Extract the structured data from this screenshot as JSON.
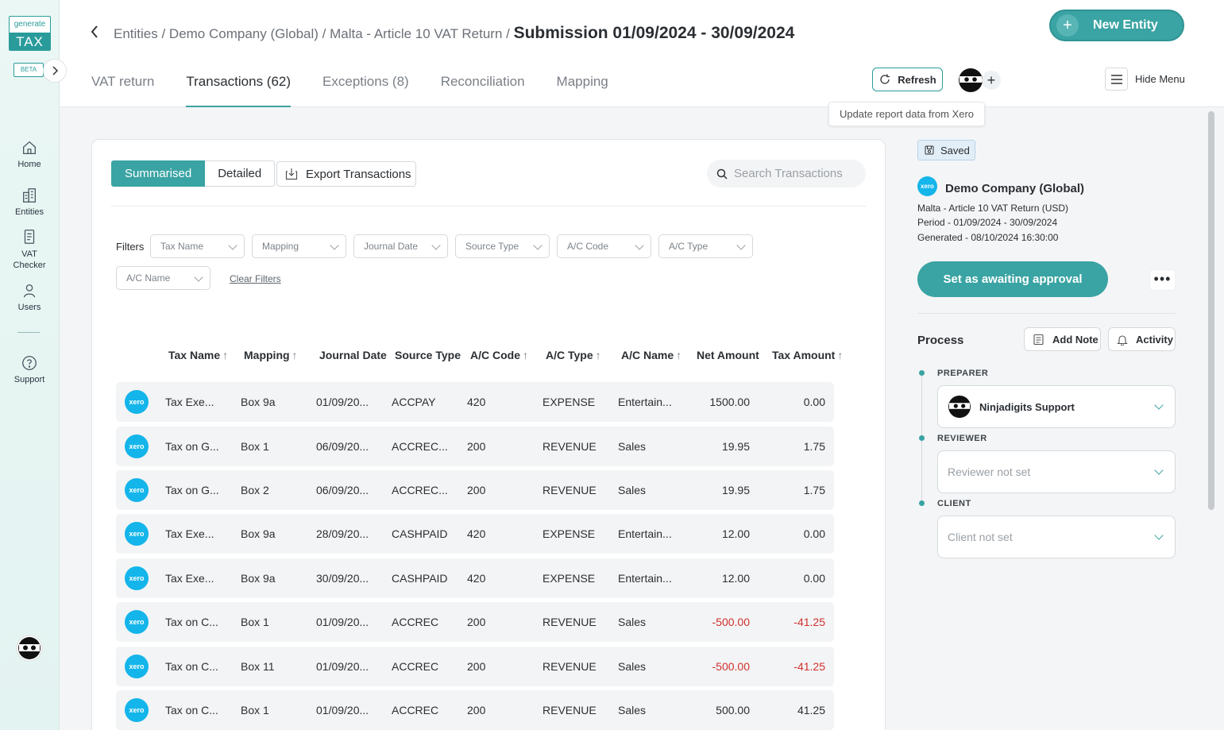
{
  "app": {
    "logo_top": "generate",
    "logo_bottom": "TAX",
    "beta": "BETA"
  },
  "sidebar": {
    "items": [
      {
        "label": "Home",
        "icon": "home-icon"
      },
      {
        "label": "Entities",
        "icon": "building-icon"
      },
      {
        "label": "VAT Checker",
        "icon": "document-icon"
      },
      {
        "label": "Users",
        "icon": "user-icon"
      },
      {
        "label": "Support",
        "icon": "help-icon"
      }
    ]
  },
  "header": {
    "breadcrumb_prefix": "Entities / Demo Company (Global) / Malta - Article 10 VAT Return / ",
    "breadcrumb_current": "Submission 01/09/2024 - 30/09/2024",
    "new_entity_label": "New Entity",
    "refresh_label": "Refresh",
    "hide_menu_label": "Hide Menu",
    "tooltip": "Update report data from Xero",
    "tabs": [
      {
        "label": "VAT return"
      },
      {
        "label": "Transactions (62)"
      },
      {
        "label": "Exceptions (8)"
      },
      {
        "label": "Reconciliation"
      },
      {
        "label": "Mapping"
      }
    ],
    "active_tab": "Transactions (62)"
  },
  "toolbar": {
    "summarised_label": "Summarised",
    "detailed_label": "Detailed",
    "export_label": "Export Transactions",
    "search_placeholder": "Search Transactions"
  },
  "filters": {
    "label": "Filters",
    "items": [
      "Tax Name",
      "Mapping",
      "Journal Date",
      "Source Type",
      "A/C Code",
      "A/C Type",
      "A/C Name"
    ],
    "clear_label": "Clear Filters"
  },
  "table": {
    "columns": [
      {
        "label": "Tax Name",
        "sortable": true
      },
      {
        "label": "Mapping",
        "sortable": true
      },
      {
        "label": "Journal Date",
        "sortable": false
      },
      {
        "label": "Source Type",
        "sortable": false
      },
      {
        "label": "A/C Code",
        "sortable": true
      },
      {
        "label": "A/C Type",
        "sortable": true
      },
      {
        "label": "A/C Name",
        "sortable": true
      },
      {
        "label": "Net Amount",
        "sortable": false
      },
      {
        "label": "Tax Amount",
        "sortable": true
      }
    ],
    "source_badge": "xero",
    "rows": [
      {
        "tax_name": "Tax Exe...",
        "mapping": "Box 9a",
        "date": "01/09/20...",
        "source": "ACCPAY",
        "code": "420",
        "type": "EXPENSE",
        "name": "Entertain...",
        "net": "1500.00",
        "tax": "0.00",
        "negative": false
      },
      {
        "tax_name": "Tax on G...",
        "mapping": "Box 1",
        "date": "06/09/20...",
        "source": "ACCREC...",
        "code": "200",
        "type": "REVENUE",
        "name": "Sales",
        "net": "19.95",
        "tax": "1.75",
        "negative": false
      },
      {
        "tax_name": "Tax on G...",
        "mapping": "Box 2",
        "date": "06/09/20...",
        "source": "ACCREC...",
        "code": "200",
        "type": "REVENUE",
        "name": "Sales",
        "net": "19.95",
        "tax": "1.75",
        "negative": false
      },
      {
        "tax_name": "Tax Exe...",
        "mapping": "Box 9a",
        "date": "28/09/20...",
        "source": "CASHPAID",
        "code": "420",
        "type": "EXPENSE",
        "name": "Entertain...",
        "net": "12.00",
        "tax": "0.00",
        "negative": false
      },
      {
        "tax_name": "Tax Exe...",
        "mapping": "Box 9a",
        "date": "30/09/20...",
        "source": "CASHPAID",
        "code": "420",
        "type": "EXPENSE",
        "name": "Entertain...",
        "net": "12.00",
        "tax": "0.00",
        "negative": false
      },
      {
        "tax_name": "Tax on C...",
        "mapping": "Box 1",
        "date": "01/09/20...",
        "source": "ACCREC",
        "code": "200",
        "type": "REVENUE",
        "name": "Sales",
        "net": "-500.00",
        "tax": "-41.25",
        "negative": true
      },
      {
        "tax_name": "Tax on C...",
        "mapping": "Box 11",
        "date": "01/09/20...",
        "source": "ACCREC",
        "code": "200",
        "type": "REVENUE",
        "name": "Sales",
        "net": "-500.00",
        "tax": "-41.25",
        "negative": true
      },
      {
        "tax_name": "Tax on C...",
        "mapping": "Box 1",
        "date": "01/09/20...",
        "source": "ACCREC",
        "code": "200",
        "type": "REVENUE",
        "name": "Sales",
        "net": "500.00",
        "tax": "41.25",
        "negative": false
      }
    ]
  },
  "right_panel": {
    "saved_label": "Saved",
    "xero_badge": "xero",
    "company": "Demo Company (Global)",
    "return_name": "Malta - Article 10 VAT Return (USD)",
    "period": "Period - 01/09/2024 - 30/09/2024",
    "generated": "Generated - 08/10/2024 16:30:00",
    "approve_label": "Set as awaiting approval",
    "more_label": "•••",
    "process_label": "Process",
    "add_note_label": "Add Note",
    "activity_label": "Activity",
    "preparer_label": "PREPARER",
    "preparer_value": "Ninjadigits Support",
    "reviewer_label": "REVIEWER",
    "reviewer_value": "Reviewer not set",
    "client_label": "CLIENT",
    "client_value": "Client not set"
  },
  "colors": {
    "accent": "#3aa3a3",
    "xero": "#13b5ea",
    "negative": "#d0312d"
  }
}
